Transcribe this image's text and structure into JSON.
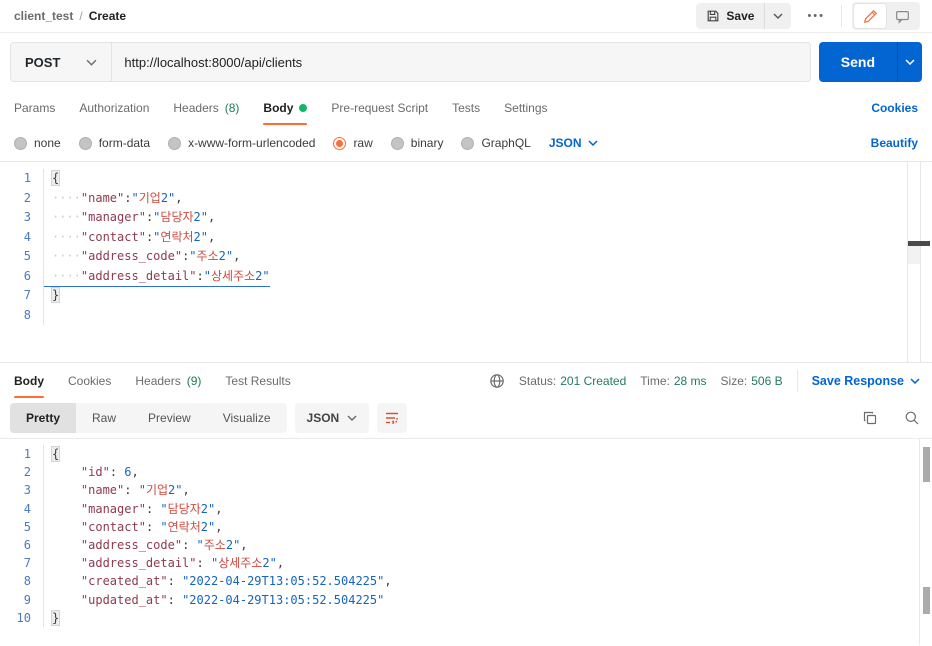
{
  "colors": {
    "accent_orange": "#FF6C37",
    "link_blue": "#0265D2",
    "status_green": "#227C5C",
    "count_green": "#1E7E4E",
    "key_maroon": "#8E3A4F",
    "string_blue": "#1565C0",
    "korean_red": "#CE4A3F"
  },
  "breadcrumb": {
    "collection": "client_test",
    "separator": "/",
    "page": "Create"
  },
  "topbar": {
    "save_label": "Save",
    "more_label": "•••"
  },
  "request": {
    "method": "POST",
    "url": "http://localhost:8000/api/clients",
    "send_label": "Send",
    "cookies_link": "Cookies",
    "tabs": [
      {
        "label": "Params"
      },
      {
        "label": "Authorization"
      },
      {
        "label": "Headers",
        "count": "(8)"
      },
      {
        "label": "Body"
      },
      {
        "label": "Pre-request Script"
      },
      {
        "label": "Tests"
      },
      {
        "label": "Settings"
      }
    ],
    "body_types": {
      "options": [
        "none",
        "form-data",
        "x-www-form-urlencoded",
        "raw",
        "binary",
        "GraphQL"
      ],
      "selected": "raw",
      "format": "JSON",
      "beautify_link": "Beautify"
    }
  },
  "request_editor": {
    "lines": [
      {
        "num": "1",
        "tokens": [
          [
            "brace",
            "{"
          ]
        ]
      },
      {
        "num": "2",
        "tokens": [
          [
            "ws",
            "····"
          ],
          [
            "key",
            "\"name\""
          ],
          [
            "punct",
            ":"
          ],
          [
            "str",
            "\""
          ],
          [
            "kor",
            "기업"
          ],
          [
            "str",
            "2\""
          ],
          [
            "punct",
            ","
          ]
        ]
      },
      {
        "num": "3",
        "tokens": [
          [
            "ws",
            "····"
          ],
          [
            "key",
            "\"manager\""
          ],
          [
            "punct",
            ":"
          ],
          [
            "str",
            "\""
          ],
          [
            "kor",
            "담당자"
          ],
          [
            "str",
            "2\""
          ],
          [
            "punct",
            ","
          ]
        ]
      },
      {
        "num": "4",
        "tokens": [
          [
            "ws",
            "····"
          ],
          [
            "key",
            "\"contact\""
          ],
          [
            "punct",
            ":"
          ],
          [
            "str",
            "\""
          ],
          [
            "kor",
            "연락처"
          ],
          [
            "str",
            "2\""
          ],
          [
            "punct",
            ","
          ]
        ]
      },
      {
        "num": "5",
        "tokens": [
          [
            "ws",
            "····"
          ],
          [
            "key",
            "\"address_code\""
          ],
          [
            "punct",
            ":"
          ],
          [
            "str",
            "\""
          ],
          [
            "kor",
            "주소"
          ],
          [
            "str",
            "2\""
          ],
          [
            "punct",
            ","
          ]
        ]
      },
      {
        "num": "6",
        "underline": true,
        "tokens": [
          [
            "ws",
            "····"
          ],
          [
            "key",
            "\"address_detail\""
          ],
          [
            "punct",
            ":"
          ],
          [
            "str",
            "\""
          ],
          [
            "kor",
            "상세주소"
          ],
          [
            "str",
            "2\""
          ]
        ]
      },
      {
        "num": "7",
        "tokens": [
          [
            "brace",
            "}"
          ]
        ]
      },
      {
        "num": "8",
        "tokens": []
      }
    ]
  },
  "response": {
    "tabs": [
      {
        "label": "Body"
      },
      {
        "label": "Cookies"
      },
      {
        "label": "Headers",
        "count": "(9)"
      },
      {
        "label": "Test Results"
      }
    ],
    "meta": {
      "status_label": "Status:",
      "status_value": "201 Created",
      "time_label": "Time:",
      "time_value": "28 ms",
      "size_label": "Size:",
      "size_value": "506 B",
      "save_response_label": "Save Response"
    },
    "toolbar": {
      "views": [
        "Pretty",
        "Raw",
        "Preview",
        "Visualize"
      ],
      "active_view": "Pretty",
      "format": "JSON"
    }
  },
  "response_editor": {
    "lines": [
      {
        "num": "1",
        "tokens": [
          [
            "brace",
            "{"
          ]
        ]
      },
      {
        "num": "2",
        "tokens": [
          [
            "ws",
            "    "
          ],
          [
            "key",
            "\"id\""
          ],
          [
            "punct",
            ": "
          ],
          [
            "num",
            "6"
          ],
          [
            "punct",
            ","
          ]
        ]
      },
      {
        "num": "3",
        "tokens": [
          [
            "ws",
            "    "
          ],
          [
            "key",
            "\"name\""
          ],
          [
            "punct",
            ": "
          ],
          [
            "str",
            "\""
          ],
          [
            "kor",
            "기업"
          ],
          [
            "str",
            "2\""
          ],
          [
            "punct",
            ","
          ]
        ]
      },
      {
        "num": "4",
        "tokens": [
          [
            "ws",
            "    "
          ],
          [
            "key",
            "\"manager\""
          ],
          [
            "punct",
            ": "
          ],
          [
            "str",
            "\""
          ],
          [
            "kor",
            "담당자"
          ],
          [
            "str",
            "2\""
          ],
          [
            "punct",
            ","
          ]
        ]
      },
      {
        "num": "5",
        "tokens": [
          [
            "ws",
            "    "
          ],
          [
            "key",
            "\"contact\""
          ],
          [
            "punct",
            ": "
          ],
          [
            "str",
            "\""
          ],
          [
            "kor",
            "연락처"
          ],
          [
            "str",
            "2\""
          ],
          [
            "punct",
            ","
          ]
        ]
      },
      {
        "num": "6",
        "tokens": [
          [
            "ws",
            "    "
          ],
          [
            "key",
            "\"address_code\""
          ],
          [
            "punct",
            ": "
          ],
          [
            "str",
            "\""
          ],
          [
            "kor",
            "주소"
          ],
          [
            "str",
            "2\""
          ],
          [
            "punct",
            ","
          ]
        ]
      },
      {
        "num": "7",
        "tokens": [
          [
            "ws",
            "    "
          ],
          [
            "key",
            "\"address_detail\""
          ],
          [
            "punct",
            ": "
          ],
          [
            "str",
            "\""
          ],
          [
            "kor",
            "상세주소"
          ],
          [
            "str",
            "2\""
          ],
          [
            "punct",
            ","
          ]
        ]
      },
      {
        "num": "8",
        "tokens": [
          [
            "ws",
            "    "
          ],
          [
            "key",
            "\"created_at\""
          ],
          [
            "punct",
            ": "
          ],
          [
            "str",
            "\"2022-04-29T13:05:52.504225\""
          ],
          [
            "punct",
            ","
          ]
        ]
      },
      {
        "num": "9",
        "tokens": [
          [
            "ws",
            "    "
          ],
          [
            "key",
            "\"updated_at\""
          ],
          [
            "punct",
            ": "
          ],
          [
            "str",
            "\"2022-04-29T13:05:52.504225\""
          ]
        ]
      },
      {
        "num": "10",
        "tokens": [
          [
            "brace",
            "}"
          ]
        ]
      }
    ]
  }
}
